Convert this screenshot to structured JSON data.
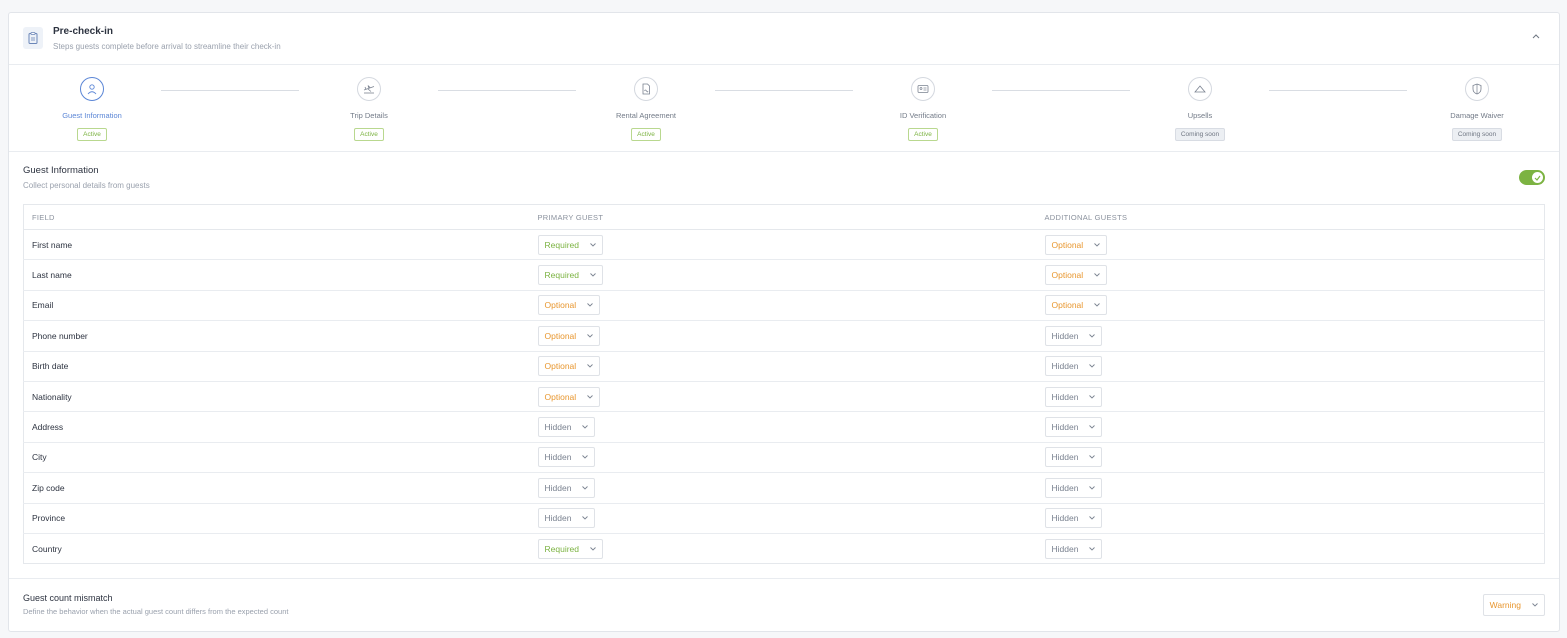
{
  "header": {
    "title": "Pre-check-in",
    "subtitle": "Steps guests complete before arrival to streamline their check-in"
  },
  "steps": [
    {
      "label": "Guest Information",
      "badge": "Active",
      "icon": "user-icon",
      "current": true
    },
    {
      "label": "Trip Details",
      "badge": "Active",
      "icon": "plane-icon",
      "current": false
    },
    {
      "label": "Rental Agreement",
      "badge": "Active",
      "icon": "document-icon",
      "current": false
    },
    {
      "label": "ID Verification",
      "badge": "Active",
      "icon": "id-card-icon",
      "current": false
    },
    {
      "label": "Upsells",
      "badge": "Coming soon",
      "icon": "hanger-icon",
      "current": false
    },
    {
      "label": "Damage Waiver",
      "badge": "Coming soon",
      "icon": "shield-icon",
      "current": false
    }
  ],
  "section": {
    "title": "Guest Information",
    "subtitle": "Collect personal details from guests",
    "enabled": true
  },
  "table": {
    "headers": [
      "FIELD",
      "PRIMARY GUEST",
      "ADDITIONAL GUESTS"
    ],
    "rows": [
      {
        "field": "First name",
        "primary": "Required",
        "additional": "Optional"
      },
      {
        "field": "Last name",
        "primary": "Required",
        "additional": "Optional"
      },
      {
        "field": "Email",
        "primary": "Optional",
        "additional": "Optional"
      },
      {
        "field": "Phone number",
        "primary": "Optional",
        "additional": "Hidden"
      },
      {
        "field": "Birth date",
        "primary": "Optional",
        "additional": "Hidden"
      },
      {
        "field": "Nationality",
        "primary": "Optional",
        "additional": "Hidden"
      },
      {
        "field": "Address",
        "primary": "Hidden",
        "additional": "Hidden"
      },
      {
        "field": "City",
        "primary": "Hidden",
        "additional": "Hidden"
      },
      {
        "field": "Zip code",
        "primary": "Hidden",
        "additional": "Hidden"
      },
      {
        "field": "Province",
        "primary": "Hidden",
        "additional": "Hidden"
      },
      {
        "field": "Country",
        "primary": "Required",
        "additional": "Hidden"
      }
    ]
  },
  "mismatch": {
    "title": "Guest count mismatch",
    "subtitle": "Define the behavior when the actual guest count differs from the expected count",
    "value": "Warning"
  },
  "colors": {
    "accent": "#5b86d6",
    "required": "#7cb342",
    "optional": "#e8962e",
    "hidden": "#7a8290"
  }
}
